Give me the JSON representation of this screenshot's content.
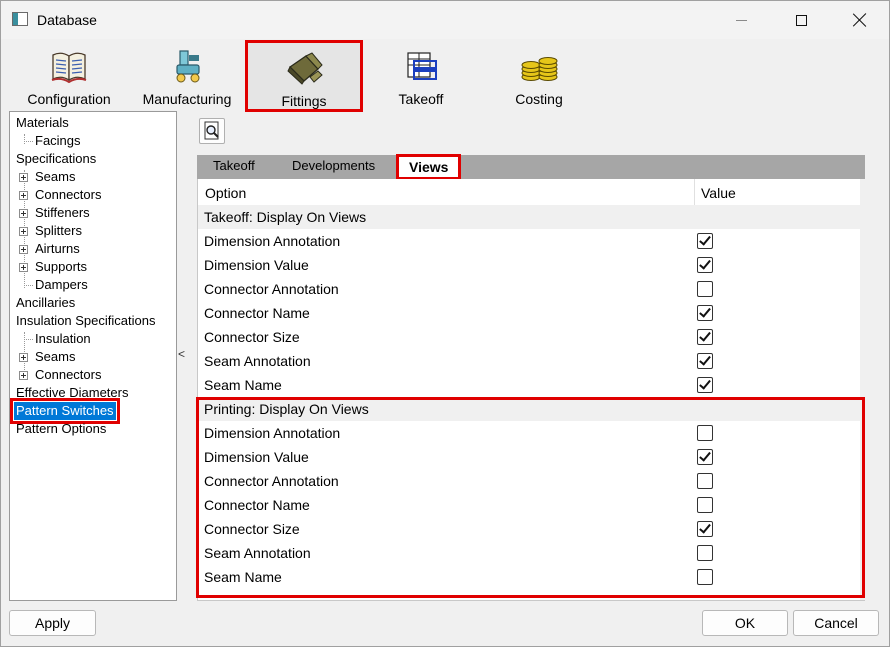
{
  "window": {
    "title": "Database"
  },
  "toolbar": {
    "items": [
      {
        "label": "Configuration",
        "icon": "book-icon"
      },
      {
        "label": "Manufacturing",
        "icon": "machine-icon"
      },
      {
        "label": "Fittings",
        "icon": "fitting-icon",
        "selected": true
      },
      {
        "label": "Takeoff",
        "icon": "takeoff-icon"
      },
      {
        "label": "Costing",
        "icon": "coins-icon"
      }
    ]
  },
  "tree": {
    "items": [
      {
        "label": "Materials"
      },
      {
        "label": "Facings"
      },
      {
        "label": "Specifications"
      },
      {
        "label": "Seams"
      },
      {
        "label": "Connectors"
      },
      {
        "label": "Stiffeners"
      },
      {
        "label": "Splitters"
      },
      {
        "label": "Airturns"
      },
      {
        "label": "Supports"
      },
      {
        "label": "Dampers"
      },
      {
        "label": "Ancillaries"
      },
      {
        "label": "Insulation Specifications"
      },
      {
        "label": "Insulation"
      },
      {
        "label": "Seams"
      },
      {
        "label": "Connectors"
      },
      {
        "label": "Effective Diameters"
      },
      {
        "label": "Pattern Switches",
        "selected": true
      },
      {
        "label": "Pattern Options"
      }
    ]
  },
  "splitter": {
    "glyph": "<"
  },
  "tabs": [
    {
      "label": "Takeoff"
    },
    {
      "label": "Developments"
    },
    {
      "label": "Views",
      "active": true
    }
  ],
  "grid": {
    "columns": {
      "option": "Option",
      "value": "Value"
    },
    "rows": [
      {
        "label": "Takeoff: Display On Views",
        "section": true
      },
      {
        "label": "Dimension Annotation",
        "checked": true
      },
      {
        "label": "Dimension Value",
        "checked": true
      },
      {
        "label": "Connector Annotation",
        "checked": false
      },
      {
        "label": "Connector Name",
        "checked": true
      },
      {
        "label": "Connector Size",
        "checked": true
      },
      {
        "label": "Seam Annotation",
        "checked": true
      },
      {
        "label": "Seam Name",
        "checked": true
      },
      {
        "label": "Printing: Display On Views",
        "section": true
      },
      {
        "label": "Dimension Annotation",
        "checked": false
      },
      {
        "label": "Dimension Value",
        "checked": true
      },
      {
        "label": "Connector Annotation",
        "checked": false
      },
      {
        "label": "Connector Name",
        "checked": false
      },
      {
        "label": "Connector Size",
        "checked": true
      },
      {
        "label": "Seam Annotation",
        "checked": false
      },
      {
        "label": "Seam Name",
        "checked": false
      }
    ]
  },
  "buttons": {
    "apply": "Apply",
    "ok": "OK",
    "cancel": "Cancel"
  },
  "colors": {
    "selection": "#0078d7",
    "highlight": "#e00000",
    "tab_strip": "#a6a6a6"
  }
}
